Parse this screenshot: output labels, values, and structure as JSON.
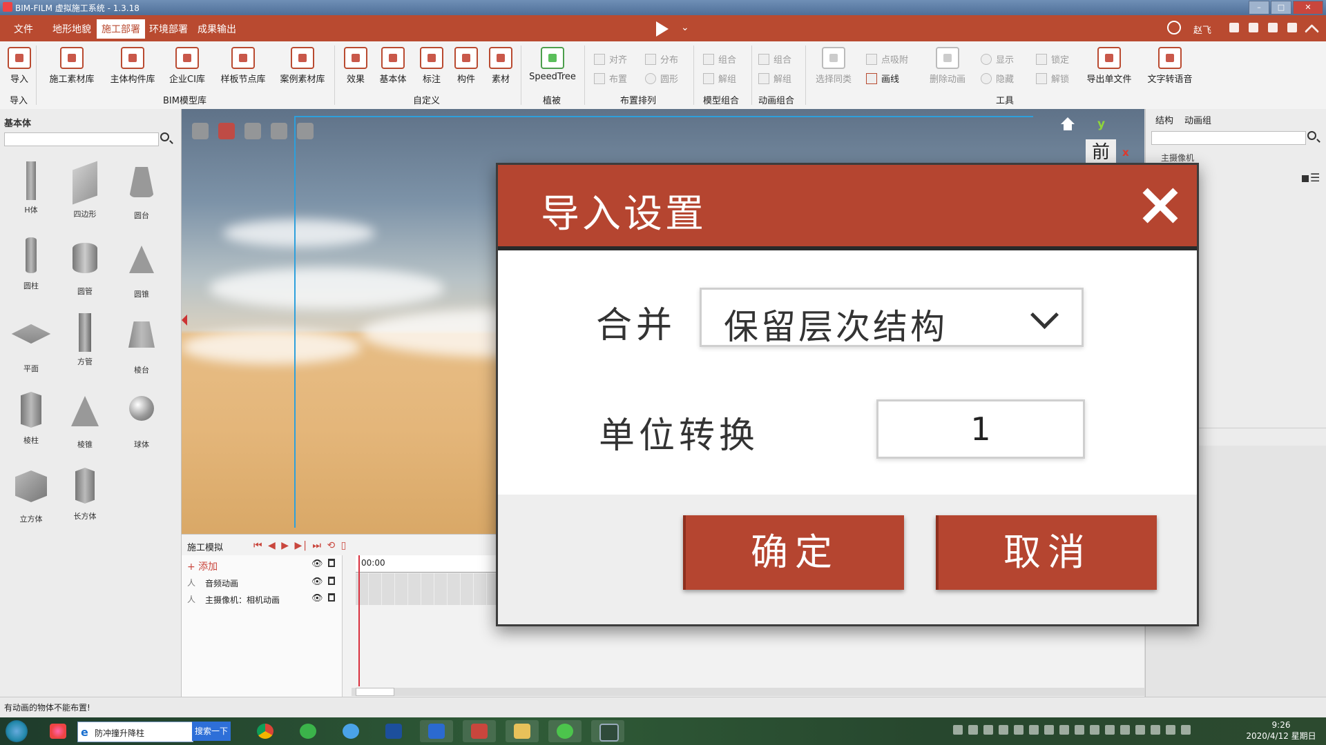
{
  "window": {
    "title": "BIM-FILM 虚拟施工系统 - 1.3.18"
  },
  "menu": {
    "items": [
      "文件",
      "地形地貌",
      "施工部署",
      "环境部署",
      "成果输出"
    ],
    "active": "施工部署",
    "user": "赵飞"
  },
  "ribbon": {
    "import_btn": "导入",
    "import_group": "导入",
    "bim_buttons": [
      "施工素材库",
      "主体构件库",
      "企业CI库",
      "样板节点库",
      "案例素材库"
    ],
    "bim_group": "BIM模型库",
    "custom_buttons": [
      "效果",
      "基本体",
      "标注",
      "构件",
      "素材"
    ],
    "custom_group": "自定义",
    "plant_button": "SpeedTree",
    "plant_group": "植被",
    "layout_small": [
      "对齐",
      "分布",
      "布置",
      "圆形"
    ],
    "layout_group": "布置排列",
    "model_small": [
      "组合",
      "解组"
    ],
    "model_group": "模型组合",
    "anim_small": [
      "组合",
      "解组"
    ],
    "anim_group": "动画组合",
    "tool_select_same": "选择同类",
    "tool_snap": "点吸附",
    "tool_draw": "画线",
    "tool_delete_anim": "删除动画",
    "tool_show": "显示",
    "tool_hide": "隐藏",
    "tool_lock": "锁定",
    "tool_unlock": "解锁",
    "tool_export": "导出单文件",
    "tool_tts": "文字转语音",
    "tool_group": "工具"
  },
  "left_panel": {
    "title": "基本体",
    "primitives": [
      "H体",
      "四边形",
      "圆台",
      "圆柱",
      "圆管",
      "圆锥",
      "平面",
      "方管",
      "棱台",
      "棱柱",
      "棱锥",
      "球体",
      "立方体",
      "长方体"
    ]
  },
  "right_panel": {
    "tabs": [
      "结构",
      "动画组"
    ],
    "item": "主摄像机"
  },
  "viewport": {
    "view_label": "前",
    "axis_y": "y",
    "axis_x": "x"
  },
  "timeline": {
    "title": "施工模拟",
    "controls": "⏮ ◀ ▶ ▶| ⏭ ⟲ ▯",
    "add": "+ 添加",
    "rows": [
      "音频动画",
      "主摄像机：相机动画"
    ],
    "time": "00:00"
  },
  "status": {
    "text": "有动画的物体不能布置!"
  },
  "taskbar": {
    "search_text": "防冲撞升降柱",
    "search_btn": "搜索一下",
    "clock_time": "9:26",
    "clock_date": "2020/4/12 星期日"
  },
  "dialog": {
    "title": "导入设置",
    "merge_label": "合并",
    "merge_value": "保留层次结构",
    "unit_label": "单位转换",
    "unit_value": "1",
    "ok": "确定",
    "cancel": "取消"
  },
  "colors": {
    "accent": "#b94a30",
    "dialog_header": "#b54530",
    "selection": "#2da0dc"
  }
}
